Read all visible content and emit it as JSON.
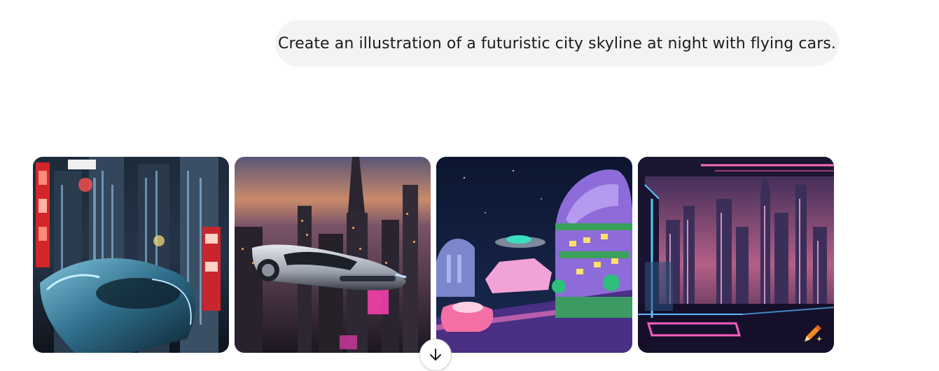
{
  "prompt": {
    "text": "Create an illustration of a futuristic city skyline at night with flying cars."
  },
  "gallery": {
    "images": [
      {
        "subject": "neon-city-flying-car"
      },
      {
        "subject": "sunset-skyline-silver-flying-car"
      },
      {
        "subject": "cartoon-purple-futuristic-city"
      },
      {
        "subject": "window-view-cyberpunk-skyline"
      }
    ],
    "edit_icon": "pencil-sparkle-icon"
  },
  "controls": {
    "scroll_down_icon": "arrow-down-icon"
  }
}
